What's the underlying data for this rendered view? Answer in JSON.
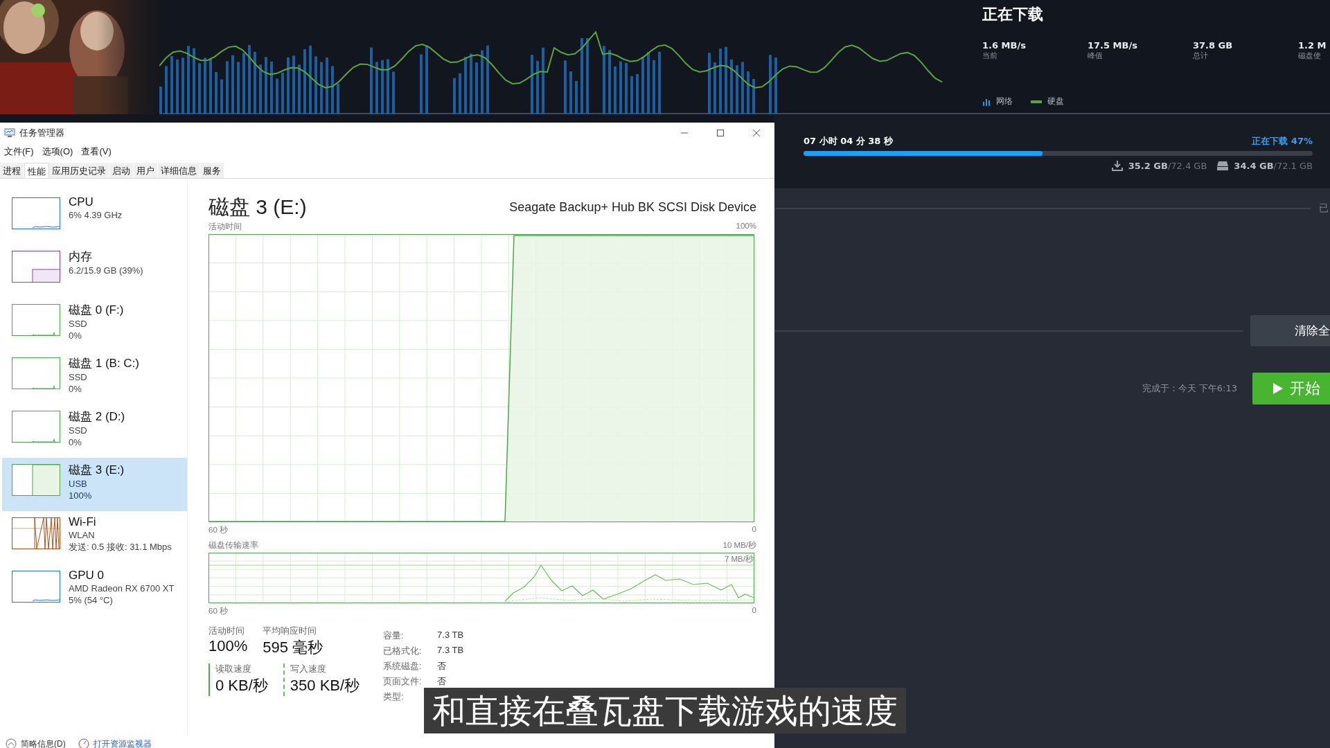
{
  "steam_header": {
    "title": "正在下载",
    "stats": [
      {
        "value": "1.6 MB/s",
        "label": "当前"
      },
      {
        "value": "17.5 MB/s",
        "label": "峰值"
      },
      {
        "value": "37.8 GB",
        "label": "总计"
      },
      {
        "value": "1.2 M",
        "label": "磁盘使"
      }
    ],
    "legend": [
      {
        "kind": "bars",
        "label": "网络"
      },
      {
        "kind": "line",
        "label": "硬盘"
      }
    ]
  },
  "task_manager": {
    "window": {
      "title": "任务管理器"
    },
    "menu": [
      "文件(F)",
      "选项(O)",
      "查看(V)"
    ],
    "tabs": [
      {
        "label": "进程",
        "selected": false
      },
      {
        "label": "性能",
        "selected": true
      },
      {
        "label": "应用历史记录",
        "selected": false
      },
      {
        "label": "启动",
        "selected": false
      },
      {
        "label": "用户",
        "selected": false
      },
      {
        "label": "详细信息",
        "selected": false
      },
      {
        "label": "服务",
        "selected": false
      }
    ],
    "sidebar": {
      "items": [
        {
          "kind": "cpu",
          "name": "CPU",
          "lines": [
            "6% 4.39 GHz"
          ],
          "selected": false
        },
        {
          "kind": "memory",
          "name": "内存",
          "lines": [
            "6.2/15.9 GB (39%)"
          ],
          "selected": false
        },
        {
          "kind": "disk",
          "name": "磁盘 0 (F:)",
          "lines": [
            "SSD",
            "0%"
          ],
          "selected": false
        },
        {
          "kind": "disk",
          "name": "磁盘 1 (B: C:)",
          "lines": [
            "SSD",
            "0%"
          ],
          "selected": false
        },
        {
          "kind": "disk",
          "name": "磁盘 2 (D:)",
          "lines": [
            "SSD",
            "0%"
          ],
          "selected": false
        },
        {
          "kind": "disk-busy",
          "name": "磁盘 3 (E:)",
          "lines": [
            "USB",
            "100%"
          ],
          "selected": true
        },
        {
          "kind": "wifi",
          "name": "Wi-Fi",
          "lines": [
            "WLAN",
            "发送: 0.5 接收: 31.1 Mbps"
          ],
          "selected": false
        },
        {
          "kind": "gpu",
          "name": "GPU 0",
          "lines": [
            "AMD Radeon RX 6700 XT",
            "5% (54 °C)"
          ],
          "selected": false
        }
      ]
    },
    "detail": {
      "title": "磁盘 3 (E:)",
      "device": "Seagate Backup+ Hub BK SCSI Disk Device",
      "activity_chart": {
        "label": "活动时间",
        "max": "100%",
        "span": "60 秒",
        "min": "0"
      },
      "transfer_chart": {
        "label": "磁盘传输速率",
        "max": "10 MB/秒",
        "marker": "7 MB/秒",
        "span": "60 秒",
        "min": "0"
      },
      "stats": [
        {
          "label": "活动时间",
          "value": "100%"
        },
        {
          "label": "平均响应时间",
          "value": "595 毫秒"
        }
      ],
      "rates": [
        {
          "kind": "read",
          "label": "读取速度",
          "value": "0 KB/秒"
        },
        {
          "kind": "write",
          "label": "写入速度",
          "value": "350 KB/秒"
        }
      ],
      "properties": [
        {
          "label": "容量:",
          "value": "7.3 TB"
        },
        {
          "label": "已格式化:",
          "value": "7.3 TB"
        },
        {
          "label": "系统磁盘:",
          "value": "否"
        },
        {
          "label": "页面文件:",
          "value": "否"
        },
        {
          "label": "类型:"
        }
      ]
    },
    "footer": [
      {
        "kind": "collapse",
        "label": "简略信息(D)"
      },
      {
        "kind": "monitor",
        "label": "打开资源监视器"
      }
    ]
  },
  "download_panel": {
    "time": "07 小时 04 分 38 秒",
    "status": "正在下载 47%",
    "level": 0.47,
    "sizes": [
      {
        "kind": "download",
        "done": "35.2 GB",
        "total": "/72.4 GB"
      },
      {
        "kind": "disk",
        "done": "34.4 GB",
        "total": "/72.1 GB"
      }
    ],
    "side_label": "已",
    "clear_button": "清除全",
    "finish": "完成于：今天 下午6:13",
    "start_button": "开始"
  },
  "subtitle": "和直接在叠瓦盘下载游戏的速度"
}
